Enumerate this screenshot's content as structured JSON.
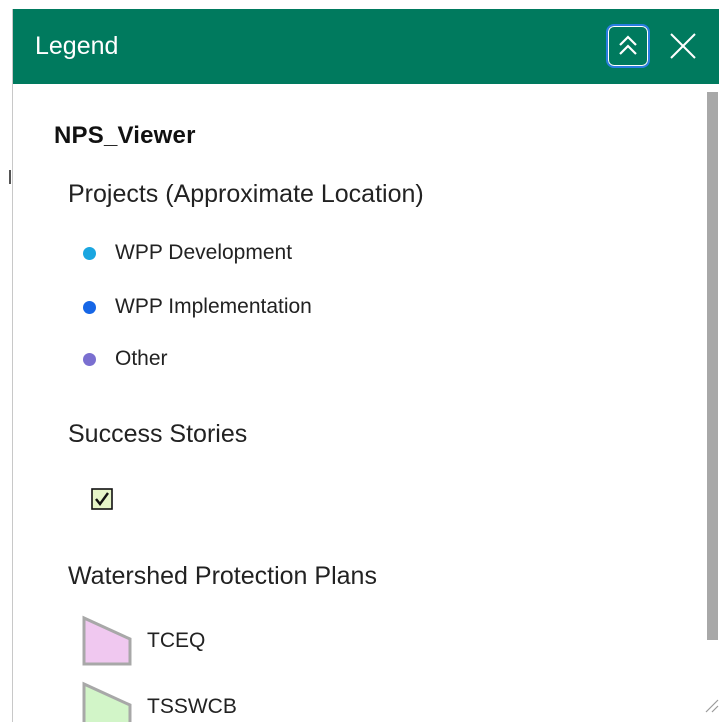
{
  "header": {
    "title": "Legend",
    "collapse_icon": "double-chevron-up-icon",
    "close_icon": "close-icon",
    "background_color": "#007a5e",
    "focus_ring_color": "#2a7de1"
  },
  "legend": {
    "service_title": "NPS_Viewer",
    "layers": [
      {
        "title": "Projects (Approximate Location)",
        "items": [
          {
            "label": "WPP Development",
            "color": "#1aa6e0"
          },
          {
            "label": "WPP Implementation",
            "color": "#1666e6"
          },
          {
            "label": "Other",
            "color": "#7a6fd0"
          }
        ]
      },
      {
        "title": "Success Stories",
        "symbol": "checkbox-check-icon",
        "symbol_fill": "#e6f5c8"
      },
      {
        "title": "Watershed Protection Plans",
        "items": [
          {
            "label": "TCEQ",
            "fill": "#f0c8f0",
            "stroke": "#a8a8a8"
          },
          {
            "label": "TSSWCB",
            "fill": "#d2f5c8",
            "stroke": "#a8a8a8"
          }
        ]
      }
    ]
  }
}
